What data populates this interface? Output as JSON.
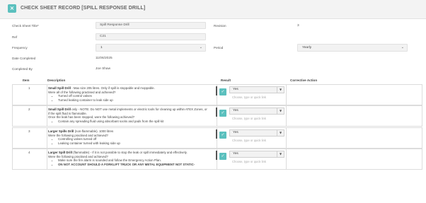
{
  "header": {
    "close_icon": "×",
    "title": "CHECK SHEET RECORD [SPILL RESPONSE DRILL]"
  },
  "form": {
    "check_sheet_title_label": "Check Sheet Title*",
    "check_sheet_title_value": "Spill Response Drill",
    "revision_label": "Revision",
    "revision_value": "3",
    "ref_label": "Ref",
    "ref_value": "C21",
    "frequency_label": "Frequency",
    "frequency_value": "1",
    "period_label": "Period",
    "period_value": "Yearly",
    "date_completed_label": "Date Completed",
    "date_completed_value": "11/06/2025",
    "completed_by_label": "Completed By",
    "completed_by_value": "Joe Shaw"
  },
  "table": {
    "headers": {
      "item": "Item",
      "description": "Description",
      "result": "Result",
      "corrective_action": "Corrective Action"
    },
    "rows": [
      {
        "item": "1",
        "title": "Small Spill Drill",
        "title_rest": " - Max size 205 litres. Only if spill is stoppable and moppable.",
        "lines": [
          "Were all of the following practised and achieved?"
        ],
        "bullets": [
          "Turned off control valves",
          "Turned leaking container to leak side up"
        ],
        "result": "Yes",
        "note": "Choose, type or quick link"
      },
      {
        "item": "2",
        "title": "Small Spill Drill",
        "title_rest": " only - NOTE: Do NOT use metal implements or electric tools for cleaning up within ATEX Zones, or",
        "lines": [
          "if the spilt fluid is flammable.",
          "Once the leak has been stopped, were the following achieved?"
        ],
        "bullets": [
          "Contain any spreading fluid using absorbant socks and pads from the spill kit"
        ],
        "result": "Yes",
        "note": "Choose, type or quick link"
      },
      {
        "item": "3",
        "title": "Larger Spills Drill",
        "title_rest": " (non-flammable). 1000 litres",
        "lines": [
          "Were the following practised and achieved?"
        ],
        "bullets": [
          "Controlling valves turned off",
          "Leaking container turned with leaking side up"
        ],
        "result": "Yes",
        "note": "Choose, type or quick link"
      },
      {
        "item": "4",
        "title": "Larger Spill Drill",
        "title_rest": " (flammable) - If it is not possible to stop the leak or spill immediately and effectively.",
        "lines": [
          "Were the following practised and achieved?"
        ],
        "bullets": [
          "Make sure the fire alarm is sounded and follow the Emergency Action Plan.",
          "ON NOT ACCOUNT SHOULD A FORKLIFT TRUCK OR ANY METAL EQUIPMENT NOT STATIC-"
        ],
        "result": "Yes",
        "note": "Choose, type or quick link"
      }
    ]
  },
  "colors": {
    "accent": "#5bc0be"
  },
  "icons": {
    "close": "close-icon",
    "check": "check-icon",
    "dropdown": "chevron-down-icon"
  }
}
